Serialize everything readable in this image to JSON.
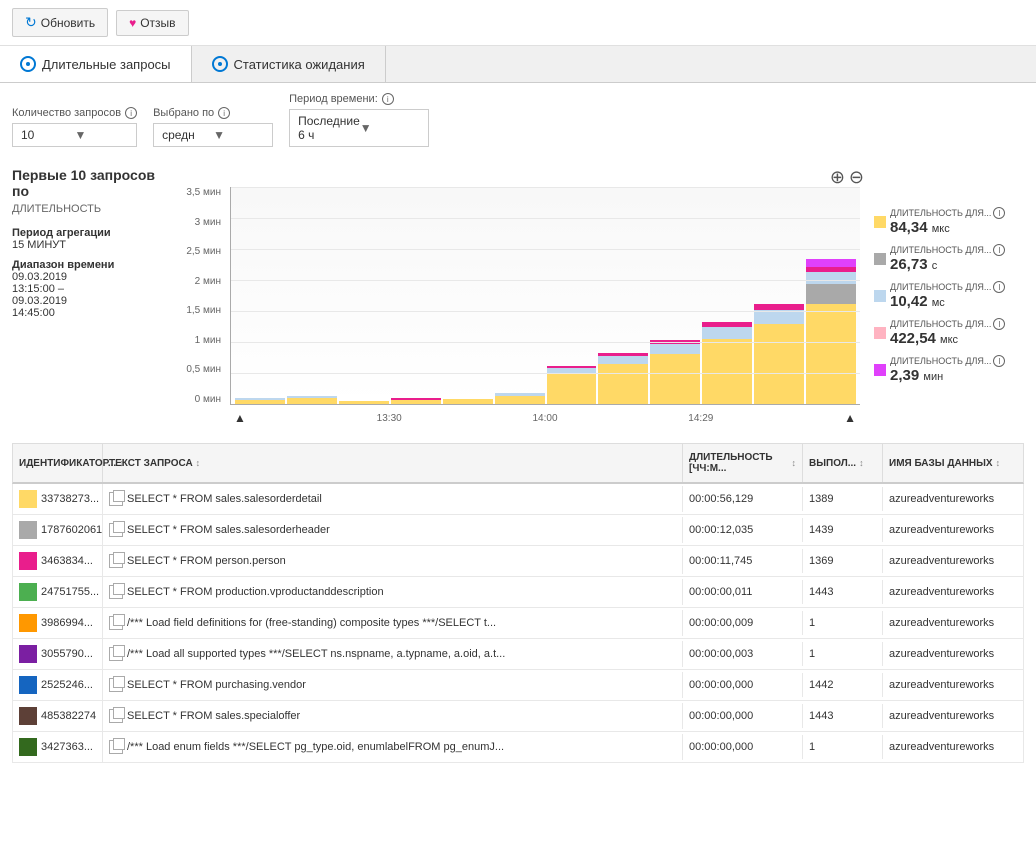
{
  "toolbar": {
    "refresh_label": "Обновить",
    "feedback_label": "Отзыв"
  },
  "tabs": [
    {
      "id": "long-queries",
      "label": "Длительные запросы",
      "active": true
    },
    {
      "id": "wait-stats",
      "label": "Статистика ожидания",
      "active": false
    }
  ],
  "filters": {
    "count_label": "Количество запросов",
    "count_value": "10",
    "sort_label": "Выбрано по",
    "sort_value": "средн",
    "period_label": "Период времени:",
    "period_value": "Последние 6 ч"
  },
  "chart": {
    "title": "Первые 10 запросов по",
    "subtitle": "ДЛИТЕЛЬНОСТЬ",
    "period_label": "Период агрегации",
    "period_value": "15 МИНУТ",
    "range_label": "Диапазон времени",
    "range_value": "09.03.2019\n13:15:00 –\n09.03.2019\n14:45:00",
    "y_labels": [
      "3,5 мин",
      "3 мин",
      "2,5 мин",
      "2 мин",
      "1,5 мин",
      "1 мин",
      "0,5 мин",
      "0 мин"
    ],
    "x_labels": [
      "13:30",
      "14:00",
      "14:29"
    ]
  },
  "legend": [
    {
      "color": "#FFD966",
      "label": "ДЛИТЕЛЬНОСТЬ ДЛЯ...",
      "value": "84,34",
      "unit": "мкс"
    },
    {
      "color": "#A9A9A9",
      "label": "ДЛИТЕЛЬНОСТЬ ДЛЯ...",
      "value": "26,73",
      "unit": "с"
    },
    {
      "color": "#BDD7EE",
      "label": "ДЛИТЕЛЬНОСТЬ ДЛЯ...",
      "value": "10,42",
      "unit": "мс"
    },
    {
      "color": "#FFB3C1",
      "label": "ДЛИТЕЛЬНОСТЬ ДЛЯ...",
      "value": "422,54",
      "unit": "мкс"
    },
    {
      "color": "#E040FB",
      "label": "ДЛИТЕЛЬНОСТЬ ДЛЯ...",
      "value": "2,39",
      "unit": "мин"
    }
  ],
  "table": {
    "headers": [
      {
        "id": "id",
        "label": "ИДЕНТИФИКАТОР...",
        "sortable": true
      },
      {
        "id": "text",
        "label": "ТЕКСТ ЗАПРОСА",
        "sortable": true
      },
      {
        "id": "dur",
        "label": "ДЛИТЕЛЬНОСТЬ [ЧЧ:М...",
        "sortable": true
      },
      {
        "id": "exec",
        "label": "ВЫПОЛ...",
        "sortable": true
      },
      {
        "id": "db",
        "label": "ИМЯ БАЗЫ ДАННЫХ",
        "sortable": true
      }
    ],
    "rows": [
      {
        "color": "#FFD966",
        "id": "33738273...",
        "text": "SELECT * FROM sales.salesorderdetail",
        "duration": "00:00:56,129",
        "executions": "1389",
        "database": "azureadventureworks"
      },
      {
        "color": "#A9A9A9",
        "id": "1787602061",
        "text": "SELECT * FROM sales.salesorderheader",
        "duration": "00:00:12,035",
        "executions": "1439",
        "database": "azureadventureworks"
      },
      {
        "color": "#E91E8C",
        "id": "3463834...",
        "text": "SELECT * FROM person.person",
        "duration": "00:00:11,745",
        "executions": "1369",
        "database": "azureadventureworks"
      },
      {
        "color": "#4CAF50",
        "id": "24751755...",
        "text": "SELECT * FROM production.vproductanddescription",
        "duration": "00:00:00,011",
        "executions": "1443",
        "database": "azureadventureworks"
      },
      {
        "color": "#FF9800",
        "id": "3986994...",
        "text": "/*** Load field definitions for (free-standing) composite types ***/SELECT t...",
        "duration": "00:00:00,009",
        "executions": "1",
        "database": "azureadventureworks"
      },
      {
        "color": "#7B1FA2",
        "id": "3055790...",
        "text": "/*** Load all supported types ***/SELECT ns.nspname, a.typname, a.oid, a.t...",
        "duration": "00:00:00,003",
        "executions": "1",
        "database": "azureadventureworks"
      },
      {
        "color": "#1565C0",
        "id": "2525246...",
        "text": "SELECT * FROM purchasing.vendor",
        "duration": "00:00:00,000",
        "executions": "1442",
        "database": "azureadventureworks"
      },
      {
        "color": "#5D4037",
        "id": "485382274",
        "text": "SELECT * FROM sales.specialoffer",
        "duration": "00:00:00,000",
        "executions": "1443",
        "database": "azureadventureworks"
      },
      {
        "color": "#33691E",
        "id": "3427363...",
        "text": "/*** Load enum fields ***/SELECT pg_type.oid, enumlabelFROM pg_enumJ...",
        "duration": "00:00:00,000",
        "executions": "1",
        "database": "azureadventureworks"
      }
    ]
  }
}
